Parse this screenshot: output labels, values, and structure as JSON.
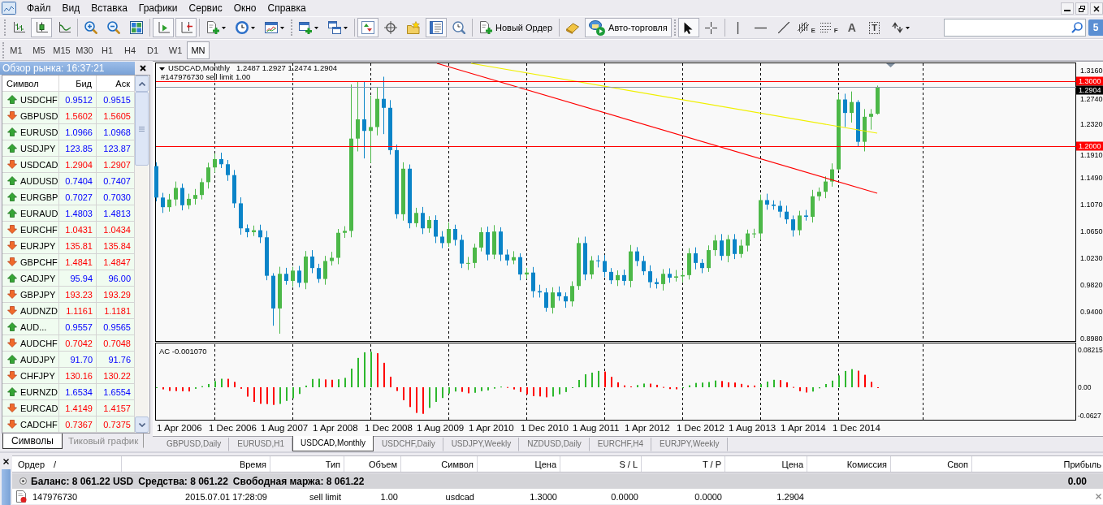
{
  "menu": [
    "Файл",
    "Вид",
    "Вставка",
    "Графики",
    "Сервис",
    "Окно",
    "Справка"
  ],
  "toolbar": {
    "buttons": [
      {
        "pressed": false
      },
      {
        "pressed": true
      },
      {
        "pressed": false
      },
      {
        "pressed": false
      },
      {
        "pressed": false
      },
      {
        "pressed": false
      },
      {
        "pressed": true
      },
      {
        "pressed": true
      },
      {
        "pressed": false
      },
      {
        "pressed": false
      },
      {
        "pressed": false
      },
      {
        "pressed": false
      },
      {
        "pressed": false
      },
      {
        "pressed": true
      },
      {
        "pressed": false
      },
      {
        "pressed": false
      },
      {
        "pressed": true
      },
      {
        "pressed": false
      }
    ],
    "new_order": "Новый Ордер",
    "autotrading": {
      "label": "Авто-торговля",
      "on": true
    },
    "tools": [
      {
        "pressed": true
      },
      {
        "pressed": false
      },
      {
        "pressed": false
      },
      {
        "pressed": false
      },
      {
        "pressed": false
      },
      {
        "pressed": false,
        "glyph": "E"
      },
      {
        "pressed": false,
        "glyph": "F"
      },
      {
        "pressed": false,
        "glyph": "A"
      },
      {
        "pressed": false,
        "glyph": "T"
      },
      {
        "pressed": false
      }
    ],
    "notifications": "5"
  },
  "timeframes": [
    {
      "label": "M1",
      "selected": false
    },
    {
      "label": "M5",
      "selected": false
    },
    {
      "label": "M15",
      "selected": false
    },
    {
      "label": "M30",
      "selected": false
    },
    {
      "label": "H1",
      "selected": false
    },
    {
      "label": "H4",
      "selected": false
    },
    {
      "label": "D1",
      "selected": false
    },
    {
      "label": "W1",
      "selected": false
    },
    {
      "label": "MN",
      "selected": true
    }
  ],
  "market_watch": {
    "title": "Обзор рынка: 16:37:21",
    "columns": [
      "Символ",
      "Бид",
      "Аск"
    ],
    "rows": [
      {
        "symbol": "USDCHF",
        "bid": "0.9512",
        "ask": "0.9515",
        "kind": "up"
      },
      {
        "symbol": "GBPUSD",
        "bid": "1.5602",
        "ask": "1.5605",
        "kind": "down"
      },
      {
        "symbol": "EURUSD",
        "bid": "1.0966",
        "ask": "1.0968",
        "kind": "up"
      },
      {
        "symbol": "USDJPY",
        "bid": "123.85",
        "ask": "123.87",
        "kind": "up"
      },
      {
        "symbol": "USDCAD",
        "bid": "1.2904",
        "ask": "1.2907",
        "kind": "down"
      },
      {
        "symbol": "AUDUSD",
        "bid": "0.7404",
        "ask": "0.7407",
        "kind": "up"
      },
      {
        "symbol": "EURGBP",
        "bid": "0.7027",
        "ask": "0.7030",
        "kind": "up"
      },
      {
        "symbol": "EURAUD",
        "bid": "1.4803",
        "ask": "1.4813",
        "kind": "up"
      },
      {
        "symbol": "EURCHF",
        "bid": "1.0431",
        "ask": "1.0434",
        "kind": "down"
      },
      {
        "symbol": "EURJPY",
        "bid": "135.81",
        "ask": "135.84",
        "kind": "down"
      },
      {
        "symbol": "GBPCHF",
        "bid": "1.4841",
        "ask": "1.4847",
        "kind": "down"
      },
      {
        "symbol": "CADJPY",
        "bid": "95.94",
        "ask": "96.00",
        "kind": "up"
      },
      {
        "symbol": "GBPJPY",
        "bid": "193.23",
        "ask": "193.29",
        "kind": "down"
      },
      {
        "symbol": "AUDNZD",
        "bid": "1.1161",
        "ask": "1.1181",
        "kind": "down"
      },
      {
        "symbol": "AUD...",
        "bid": "0.9557",
        "ask": "0.9565",
        "kind": "up"
      },
      {
        "symbol": "AUDCHF",
        "bid": "0.7042",
        "ask": "0.7048",
        "kind": "down"
      },
      {
        "symbol": "AUDJPY",
        "bid": "91.70",
        "ask": "91.76",
        "kind": "up"
      },
      {
        "symbol": "CHFJPY",
        "bid": "130.16",
        "ask": "130.22",
        "kind": "down"
      },
      {
        "symbol": "EURNZD",
        "bid": "1.6534",
        "ask": "1.6554",
        "kind": "up"
      },
      {
        "symbol": "EURCAD",
        "bid": "1.4149",
        "ask": "1.4157",
        "kind": "down"
      },
      {
        "symbol": "CADCHF",
        "bid": "0.7367",
        "ask": "0.7375",
        "kind": "down"
      }
    ],
    "tabs": [
      {
        "label": "Символы",
        "selected": true
      },
      {
        "label": "Тиковый график",
        "selected": false
      }
    ]
  },
  "chart": {
    "title": "USDCAD,Monthly",
    "ohlc": "1.2487 1.2927 1.2474 1.2904",
    "order_label": "#147976730 sell limit 1.00",
    "price_labels": [
      "1.3160",
      "1.2740",
      "1.2320",
      "1.1910",
      "1.1490",
      "1.1070",
      "1.0650",
      "1.0230",
      "0.9820",
      "0.9400",
      "0.8980"
    ],
    "price_tags": [
      {
        "text": "1.3000",
        "kind": "order"
      },
      {
        "text": "1.2904",
        "kind": "bid"
      },
      {
        "text": "1.2000",
        "kind": "level"
      }
    ],
    "time_labels": [
      "1 Apr 2006",
      "1 Dec 2006",
      "1 Aug 2007",
      "1 Apr 2008",
      "1 Dec 2008",
      "1 Aug 2009",
      "1 Apr 2010",
      "1 Dec 2010",
      "1 Aug 2011",
      "1 Apr 2012",
      "1 Dec 2012",
      "1 Aug 2013",
      "1 Apr 2014",
      "1 Dec 2014"
    ],
    "indicator": {
      "label": "AC -0.001070",
      "scale_labels": [
        "0.08215",
        "0.00",
        "-0.0627"
      ]
    }
  },
  "chart_tabs": [
    {
      "label": "GBPUSD,Daily",
      "selected": false
    },
    {
      "label": "EURUSD,H1",
      "selected": false
    },
    {
      "label": "USDCAD,Monthly",
      "selected": true
    },
    {
      "label": "USDCHF,Daily",
      "selected": false
    },
    {
      "label": "USDJPY,Weekly",
      "selected": false
    },
    {
      "label": "NZDUSD,Daily",
      "selected": false
    },
    {
      "label": "EURCHF,H4",
      "selected": false
    },
    {
      "label": "EURJPY,Weekly",
      "selected": false
    }
  ],
  "terminal": {
    "columns": [
      "Ордер",
      "Время",
      "Тип",
      "Объем",
      "Символ",
      "Цена",
      "S / L",
      "T / P",
      "Цена",
      "Комиссия",
      "Своп",
      "Прибыль"
    ],
    "sort_indicator": "/",
    "summary": [
      "Баланс: 8 061.22 USD",
      "Средства: 8 061.22",
      "Свободная маржа: 8 061.22"
    ],
    "profit": "0.00",
    "orders": [
      {
        "cells": [
          "147976730",
          "2015.07.01 17:28:09",
          "sell limit",
          "1.00",
          "usdcad",
          "1.3000",
          "0.0000",
          "0.0000",
          "1.2904"
        ]
      }
    ]
  }
}
